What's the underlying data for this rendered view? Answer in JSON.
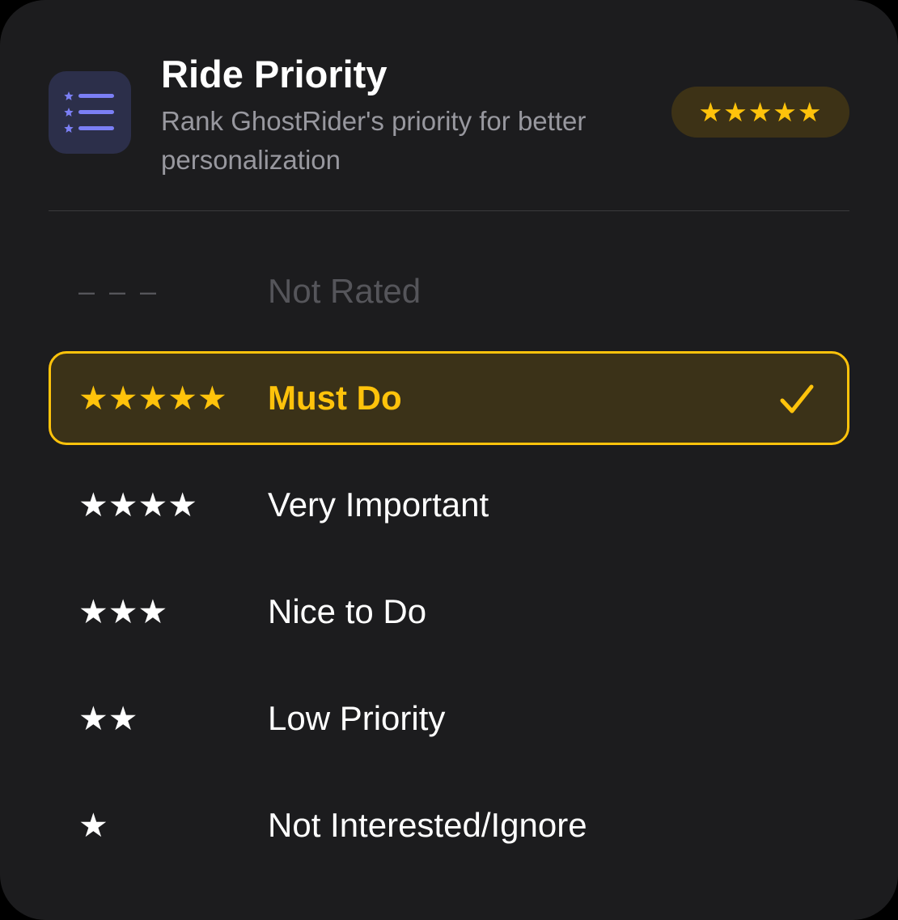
{
  "header": {
    "title": "Ride Priority",
    "subtitle": "Rank GhostRider's priority for better personalization",
    "badge_stars": "★★★★★",
    "icon": "starred-list-icon"
  },
  "options": [
    {
      "stars": "– – –",
      "label": "Not Rated",
      "state": "disabled"
    },
    {
      "stars": "★★★★★",
      "label": "Must Do",
      "state": "selected"
    },
    {
      "stars": "★★★★",
      "label": "Very Important",
      "state": "normal"
    },
    {
      "stars": "★★★",
      "label": "Nice to Do",
      "state": "normal"
    },
    {
      "stars": "★★",
      "label": "Low Priority",
      "state": "normal"
    },
    {
      "stars": "★",
      "label": "Not Interested/Ignore",
      "state": "normal"
    }
  ],
  "colors": {
    "background": "#1c1c1e",
    "accent": "#ffc30b",
    "icon_tint": "#7b7ff5"
  }
}
